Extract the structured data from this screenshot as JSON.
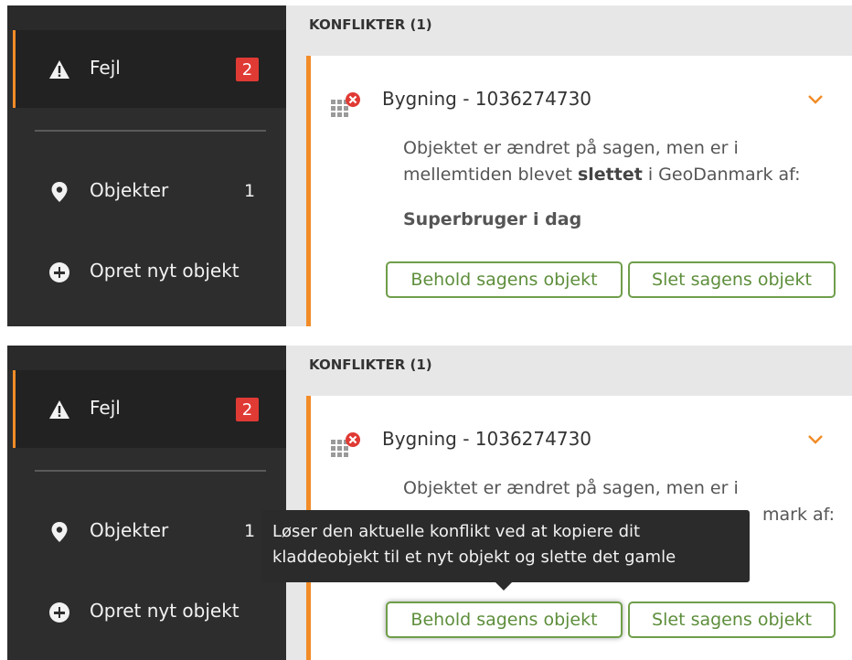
{
  "panels": [
    {
      "sidebar": {
        "items": [
          {
            "label": "Fejl",
            "badge": "2",
            "icon": "warning-icon"
          },
          {
            "label": "Objekter",
            "count": "1",
            "icon": "map-pin-icon"
          },
          {
            "label": "Opret nyt objekt",
            "icon": "plus-circle-icon"
          }
        ]
      },
      "section_header": "KONFLIKTER (1)",
      "card": {
        "title": "Bygning - 1036274730",
        "message_line1": "Objektet er ændret på sagen, men er i",
        "message_line2_pre": "mellemtiden blevet ",
        "message_bold": "slettet",
        "message_line2_post": " i GeoDanmark af:",
        "author": "Superbruger i dag",
        "keep_button": "Behold sagens objekt",
        "delete_button": "Slet sagens objekt"
      }
    },
    {
      "sidebar": {
        "items": [
          {
            "label": "Fejl",
            "badge": "2",
            "icon": "warning-icon"
          },
          {
            "label": "Objekter",
            "count": "1",
            "icon": "map-pin-icon"
          },
          {
            "label": "Opret nyt objekt",
            "icon": "plus-circle-icon"
          }
        ]
      },
      "section_header": "KONFLIKTER (1)",
      "card": {
        "title": "Bygning - 1036274730",
        "message_line1": "Objektet er ændret på sagen, men er i",
        "message_line2_visible": "mark af:",
        "keep_button": "Behold sagens objekt",
        "delete_button": "Slet sagens objekt"
      },
      "tooltip": {
        "line1": "Løser den aktuelle konflikt ved at kopiere dit",
        "line2": "kladdeobjekt til et nyt objekt og slette det gamle"
      }
    }
  ],
  "colors": {
    "accent": "#f28c28",
    "badge": "#e03a34",
    "button_border": "#6f9e4a",
    "sidebar_bg": "#2d2d2d",
    "tooltip_bg": "#2b2b2b"
  }
}
